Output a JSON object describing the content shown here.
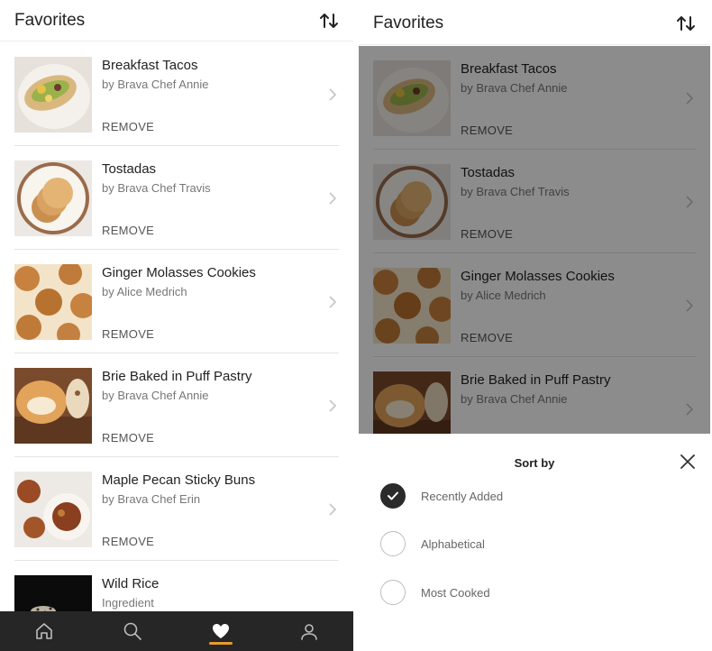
{
  "left": {
    "header": {
      "title": "Favorites"
    },
    "items": [
      {
        "title": "Breakfast Tacos",
        "subtitle": "by Brava Chef Annie",
        "action": "REMOVE",
        "image": "breakfast-tacos-photo"
      },
      {
        "title": "Tostadas",
        "subtitle": "by Brava Chef Travis",
        "action": "REMOVE",
        "image": "tostadas-photo"
      },
      {
        "title": "Ginger Molasses Cookies",
        "subtitle": "by Alice Medrich",
        "action": "REMOVE",
        "image": "cookies-photo"
      },
      {
        "title": "Brie Baked in Puff Pastry",
        "subtitle": "by Brava Chef Annie",
        "action": "REMOVE",
        "image": "brie-photo"
      },
      {
        "title": "Maple Pecan Sticky Buns",
        "subtitle": "by Brava Chef Erin",
        "action": "REMOVE",
        "image": "sticky-buns-photo"
      },
      {
        "title": "Wild Rice",
        "subtitle": "Ingredient",
        "action": "",
        "image": "wild-rice-photo"
      }
    ],
    "tabbar": {
      "tabs": [
        {
          "icon": "home-icon"
        },
        {
          "icon": "search-icon"
        },
        {
          "icon": "heart-icon",
          "active": true
        },
        {
          "icon": "profile-icon"
        }
      ]
    }
  },
  "right": {
    "header": {
      "title": "Favorites"
    },
    "items": [
      {
        "title": "Breakfast Tacos",
        "subtitle": "by Brava Chef Annie",
        "action": "REMOVE"
      },
      {
        "title": "Tostadas",
        "subtitle": "by Brava Chef Travis",
        "action": "REMOVE"
      },
      {
        "title": "Ginger Molasses Cookies",
        "subtitle": "by Alice Medrich",
        "action": "REMOVE"
      },
      {
        "title": "Brie Baked in Puff Pastry",
        "subtitle": "by Brava Chef Annie",
        "action": ""
      }
    ],
    "sheet": {
      "title": "Sort by",
      "options": [
        {
          "label": "Recently Added",
          "selected": true
        },
        {
          "label": "Alphabetical",
          "selected": false
        },
        {
          "label": "Most Cooked",
          "selected": false
        }
      ]
    }
  },
  "colors": {
    "accent": "#e89a2f",
    "tabbar": "#262626",
    "overlay": "rgba(0,0,0,0.45)"
  }
}
